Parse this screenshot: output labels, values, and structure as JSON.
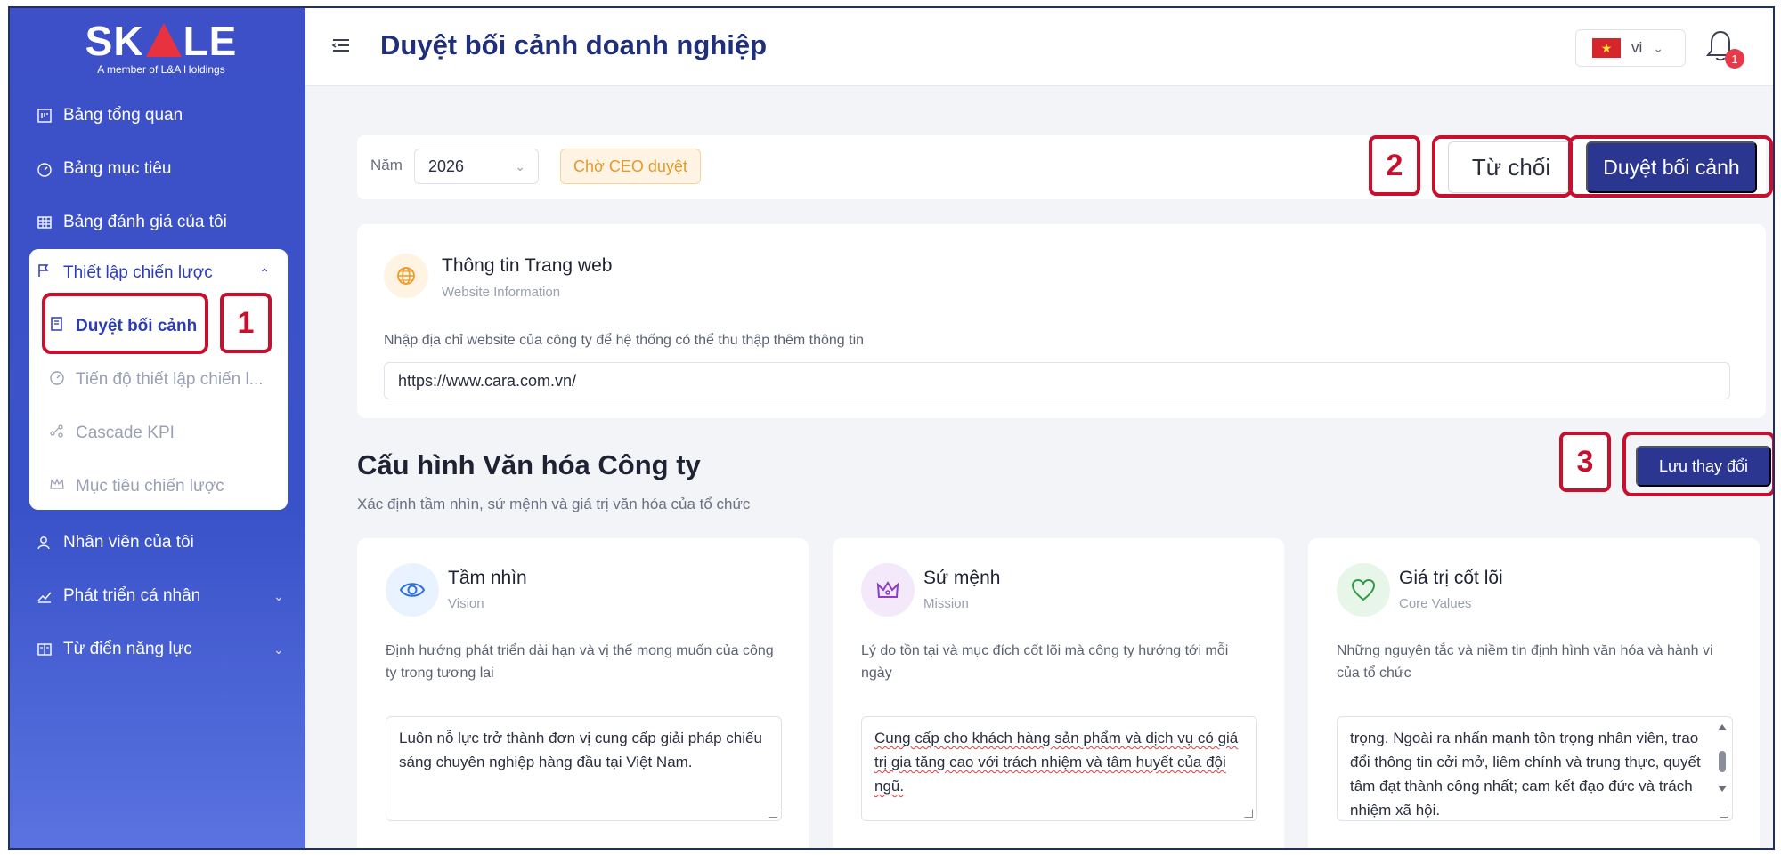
{
  "brand": {
    "logo_text_left": "SK",
    "logo_text_right": "LE",
    "logo_sub": "A member of L&A Holdings"
  },
  "sidebar": {
    "items": [
      {
        "label": "Bảng tổng quan",
        "icon": "dashboard-icon"
      },
      {
        "label": "Bảng mục tiêu",
        "icon": "gauge-icon"
      },
      {
        "label": "Bảng đánh giá của tôi",
        "icon": "grid-icon"
      },
      {
        "label": "Nhân viên của tôi",
        "icon": "users-icon"
      },
      {
        "label": "Phát triển cá nhân",
        "icon": "chart-icon"
      },
      {
        "label": "Từ điển năng lực",
        "icon": "book-icon"
      }
    ],
    "strategy": {
      "label": "Thiết lập chiến lược",
      "items": [
        {
          "label": "Duyệt bối cảnh"
        },
        {
          "label": "Tiến độ thiết lập chiến l..."
        },
        {
          "label": "Cascade KPI"
        },
        {
          "label": "Mục tiêu chiến lược"
        }
      ]
    }
  },
  "header": {
    "title": "Duyệt bối cảnh doanh nghiệp",
    "lang": "vi",
    "notification_count": "1"
  },
  "toolbar": {
    "year_label": "Năm",
    "year_value": "2026",
    "status": "Chờ CEO duyệt",
    "reject_label": "Từ chối",
    "approve_label": "Duyệt bối cảnh"
  },
  "website": {
    "title": "Thông tin Trang web",
    "subtitle": "Website Information",
    "description": "Nhập địa chỉ website của công ty để hệ thống có thể thu thập thêm thông tin",
    "url": "https://www.cara.com.vn/"
  },
  "culture": {
    "title": "Cấu hình Văn hóa Công ty",
    "subtitle": "Xác định tầm nhìn, sứ mệnh và giá trị văn hóa của tổ chức",
    "save_label": "Lưu thay đổi",
    "cards": [
      {
        "title": "Tầm nhìn",
        "subtitle": "Vision",
        "description": "Định hướng phát triển dài hạn và vị thế mong muốn của công ty trong tương lai",
        "text": "Luôn nỗ lực trở thành đơn vị cung cấp giải pháp chiếu sáng chuyên nghiệp hàng đầu tại Việt Nam."
      },
      {
        "title": "Sứ mệnh",
        "subtitle": "Mission",
        "description": "Lý do tồn tại và mục đích cốt lõi mà công ty hướng tới mỗi ngày",
        "text": "Cung cấp cho khách hàng sản phẩm và dịch vụ có giá trị gia tăng cao với trách nhiệm và tâm huyết của đội ngũ."
      },
      {
        "title": "Giá trị cốt lõi",
        "subtitle": "Core Values",
        "description": "Những nguyên tắc và niềm tin định hình văn hóa và hành vi của tổ chức",
        "text": "trọng. Ngoài ra nhấn mạnh tôn trọng nhân viên, trao đổi thông tin cởi mở, liêm chính và trung thực, quyết tâm đạt thành công nhất; cam kết đạo đức và trách nhiệm xã hội."
      }
    ]
  },
  "annotations": [
    "1",
    "2",
    "3"
  ],
  "colors": {
    "sidebar": "#3d50c8",
    "primary": "#2a3690",
    "accent_red": "#c8102e",
    "status_orange": "#e59a2c"
  }
}
